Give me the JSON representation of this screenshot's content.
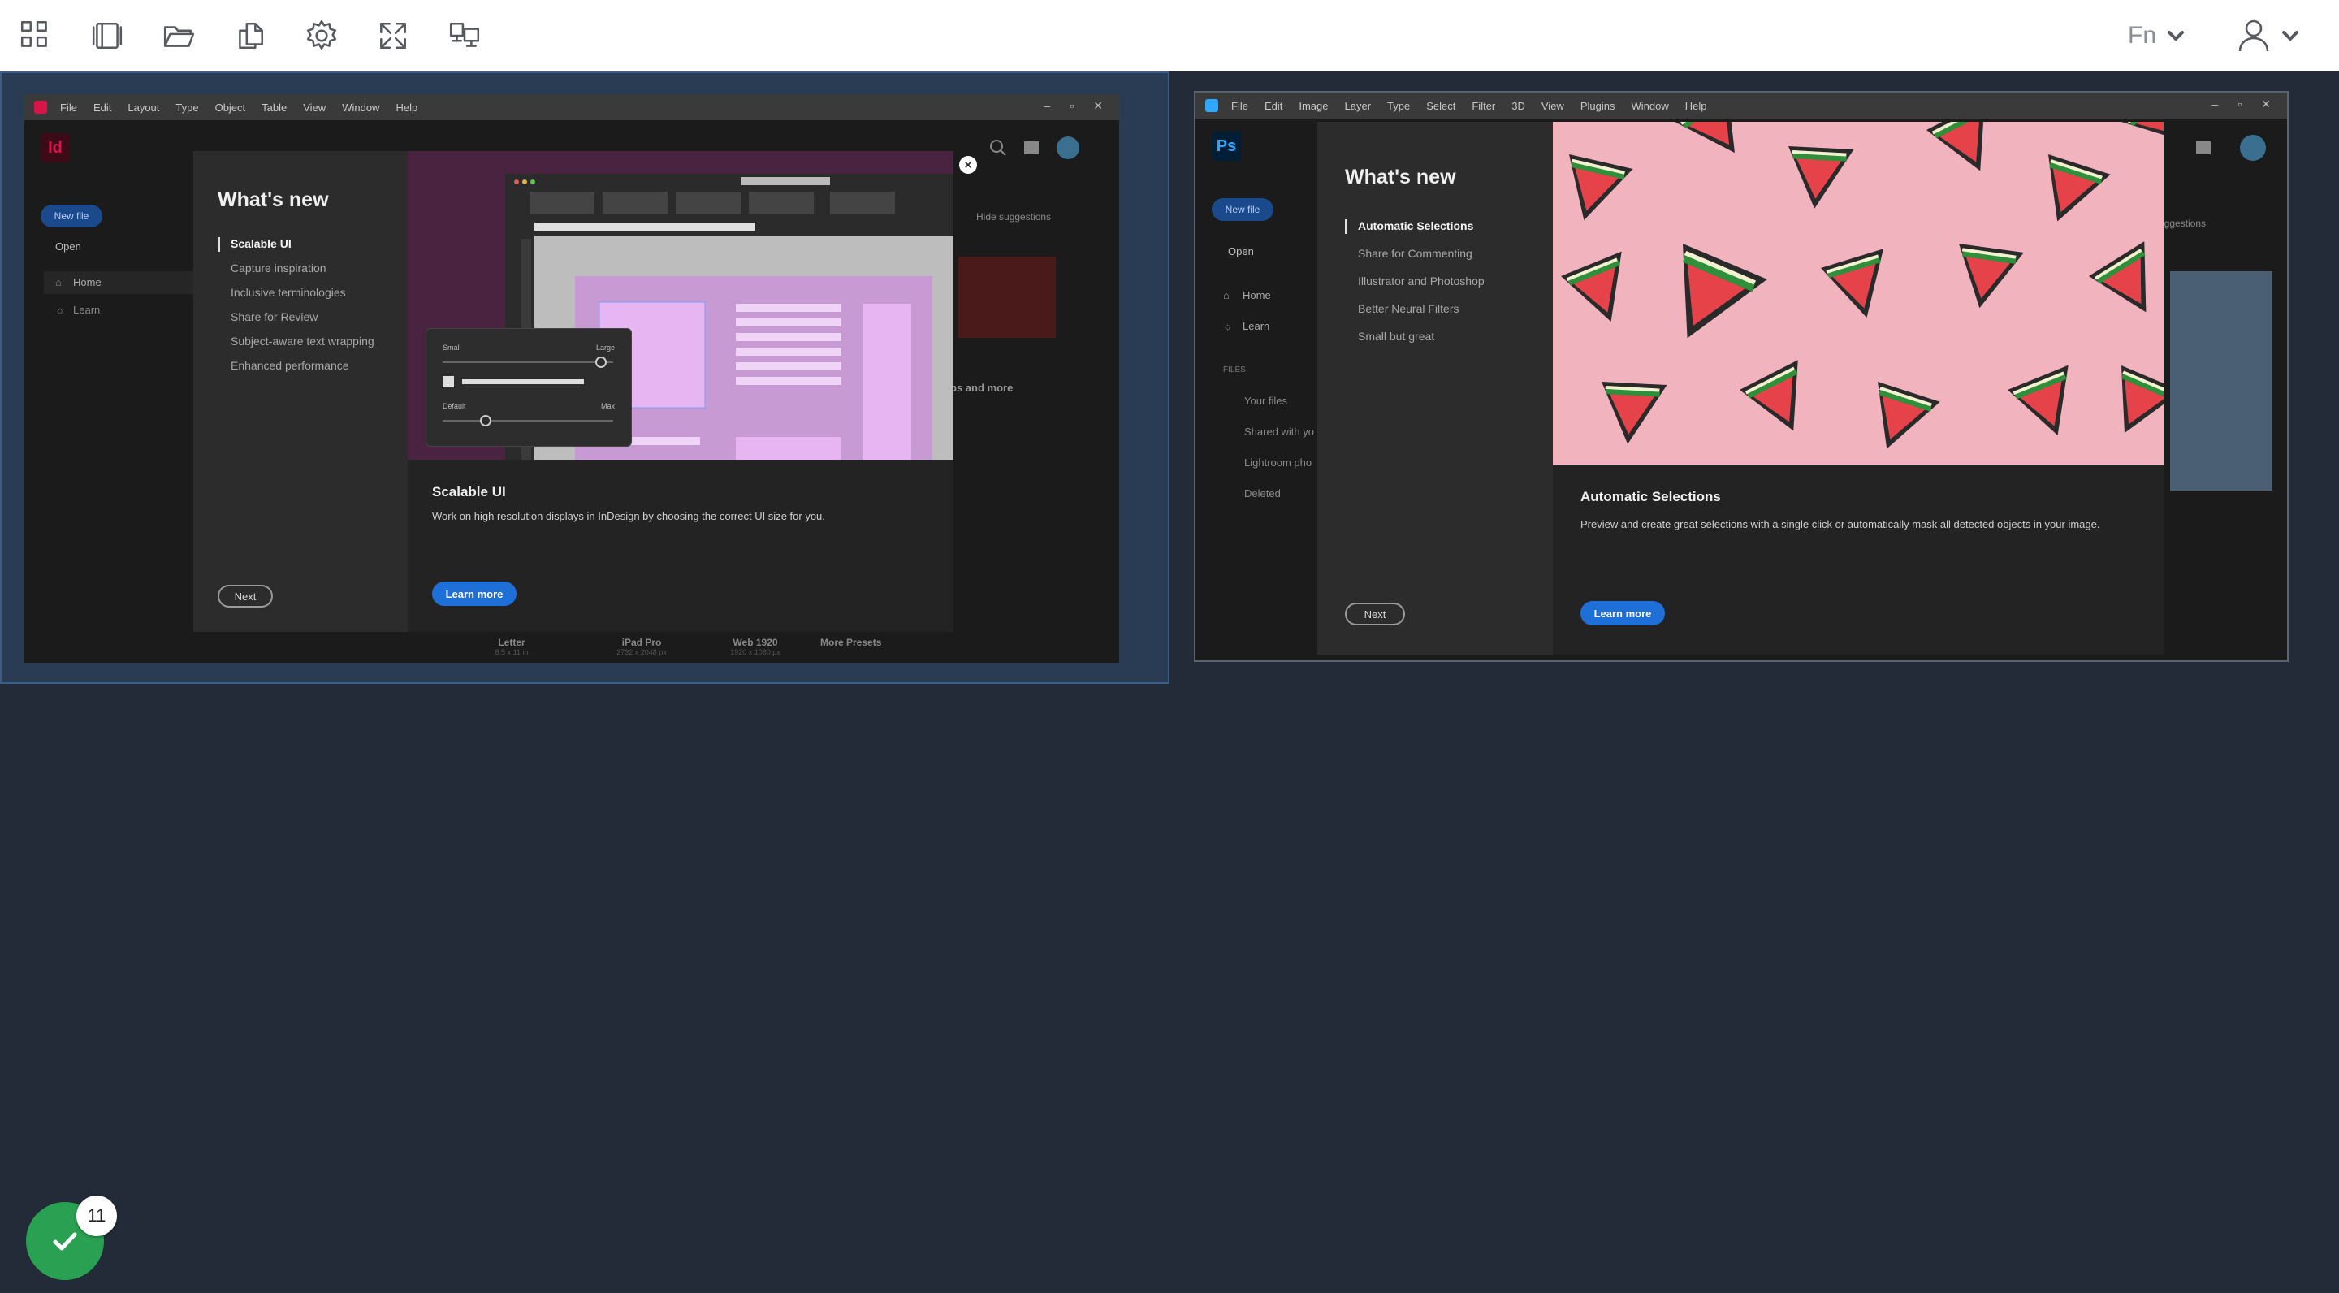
{
  "toolbar": {
    "icons": [
      "grid-icon",
      "panel-icon",
      "folder-open-icon",
      "copy-icon",
      "gear-icon",
      "expand-icon",
      "monitor-icon"
    ],
    "fn_label": "Fn"
  },
  "thumbnails": {
    "indesign": {
      "logo": "Id",
      "menu": [
        "File",
        "Edit",
        "Layout",
        "Type",
        "Object",
        "Table",
        "View",
        "Window",
        "Help"
      ],
      "new_file": "New file",
      "open": "Open",
      "nav": [
        "Home",
        "Learn"
      ],
      "hide_suggestions": "Hide suggestions",
      "more_label": "ps and more",
      "presets": [
        "Letter",
        "iPad Pro",
        "Web 1920",
        "More Presets"
      ],
      "preset_sizes": [
        "8.5 x 11 in",
        "2732 x 2048 px",
        "1920 x 1080 px"
      ],
      "dialog": {
        "title": "What's new",
        "items": [
          "Scalable UI",
          "Capture inspiration",
          "Inclusive terminologies",
          "Share for Review",
          "Subject-aware text wrapping",
          "Enhanced performance"
        ],
        "active_index": 0,
        "next": "Next",
        "feature_title": "Scalable UI",
        "feature_desc": "Work on high resolution displays in InDesign by choosing the correct UI size for you.",
        "learn_more": "Learn more",
        "preview": {
          "small": "Small",
          "large": "Large",
          "default": "Default",
          "max": "Max"
        }
      }
    },
    "photoshop": {
      "logo": "Ps",
      "menu": [
        "File",
        "Edit",
        "Image",
        "Layer",
        "Type",
        "Select",
        "Filter",
        "3D",
        "View",
        "Plugins",
        "Window",
        "Help"
      ],
      "new_file": "New file",
      "open": "Open",
      "nav": [
        "Home",
        "Learn"
      ],
      "files_header": "FILES",
      "files": [
        "Your files",
        "Shared with yo",
        "Lightroom pho",
        "Deleted"
      ],
      "suggestions": "suggestions",
      "dialog": {
        "title": "What's new",
        "items": [
          "Automatic Selections",
          "Share for Commenting",
          "Illustrator and Photoshop",
          "Better Neural Filters",
          "Small but great"
        ],
        "active_index": 0,
        "next": "Next",
        "feature_title": "Automatic Selections",
        "feature_desc": "Preview and create great selections with a single click or automatically mask all detected objects in your image.",
        "learn_more": "Learn more"
      }
    }
  },
  "status": {
    "count": "11"
  },
  "colors": {
    "accent": "#1f6fd8",
    "success": "#2aa152",
    "background": "#222b37",
    "indesign": "#d7154a",
    "photoshop": "#31a8ff"
  }
}
